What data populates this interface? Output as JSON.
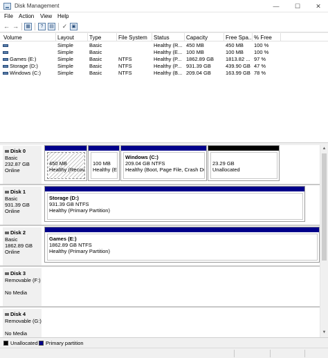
{
  "window": {
    "title": "Disk Management"
  },
  "menu": [
    "File",
    "Action",
    "View",
    "Help"
  ],
  "volume_table": {
    "columns": [
      "Volume",
      "Layout",
      "Type",
      "File System",
      "Status",
      "Capacity",
      "Free Spa...",
      "% Free"
    ],
    "rows": [
      {
        "volume": "",
        "layout": "Simple",
        "type": "Basic",
        "fs": "",
        "status": "Healthy (R...",
        "capacity": "450 MB",
        "free": "450 MB",
        "pct": "100 %"
      },
      {
        "volume": "",
        "layout": "Simple",
        "type": "Basic",
        "fs": "",
        "status": "Healthy (E...",
        "capacity": "100 MB",
        "free": "100 MB",
        "pct": "100 %"
      },
      {
        "volume": "Games (E:)",
        "layout": "Simple",
        "type": "Basic",
        "fs": "NTFS",
        "status": "Healthy (P...",
        "capacity": "1862.89 GB",
        "free": "1813.82 ...",
        "pct": "97 %"
      },
      {
        "volume": "Storage (D:)",
        "layout": "Simple",
        "type": "Basic",
        "fs": "NTFS",
        "status": "Healthy (P...",
        "capacity": "931.39 GB",
        "free": "439.90 GB",
        "pct": "47 %"
      },
      {
        "volume": "Windows (C:)",
        "layout": "Simple",
        "type": "Basic",
        "fs": "NTFS",
        "status": "Healthy (B...",
        "capacity": "209.04 GB",
        "free": "163.99 GB",
        "pct": "78 %"
      }
    ]
  },
  "disks": [
    {
      "name": "Disk 0",
      "type": "Basic",
      "size": "232.87 GB",
      "status": "Online",
      "partitions": [
        {
          "line1": "450 MB",
          "line2": "Healthy (Recove"
        },
        {
          "line1": "100 MB",
          "line2": "Healthy (EFI"
        },
        {
          "title": "Windows  (C:)",
          "line1": "209.04 GB NTFS",
          "line2": "Healthy (Boot, Page File, Crash Dum"
        },
        {
          "line1": "23.29 GB",
          "line2": "Unallocated"
        }
      ]
    },
    {
      "name": "Disk 1",
      "type": "Basic",
      "size": "931.39 GB",
      "status": "Online",
      "partitions": [
        {
          "title": "Storage  (D:)",
          "line1": "931.39 GB NTFS",
          "line2": "Healthy (Primary Partition)"
        }
      ]
    },
    {
      "name": "Disk 2",
      "type": "Basic",
      "size": "1862.89 GB",
      "status": "Online",
      "partitions": [
        {
          "title": "Games  (E:)",
          "line1": "1862.89 GB NTFS",
          "line2": "Healthy (Primary Partition)"
        }
      ]
    },
    {
      "name": "Disk 3",
      "type": "Removable (F:)",
      "status": "No Media"
    },
    {
      "name": "Disk 4",
      "type": "Removable (G:)",
      "status": "No Media"
    }
  ],
  "legend": {
    "unallocated": "Unallocated",
    "primary": "Primary partition"
  },
  "colors": {
    "primary": "#00008a",
    "unallocated": "#000000"
  },
  "icons": [
    "back-arrow-icon",
    "forward-arrow-icon",
    "disk-list-icon",
    "help-icon",
    "properties-icon",
    "console-icon"
  ]
}
